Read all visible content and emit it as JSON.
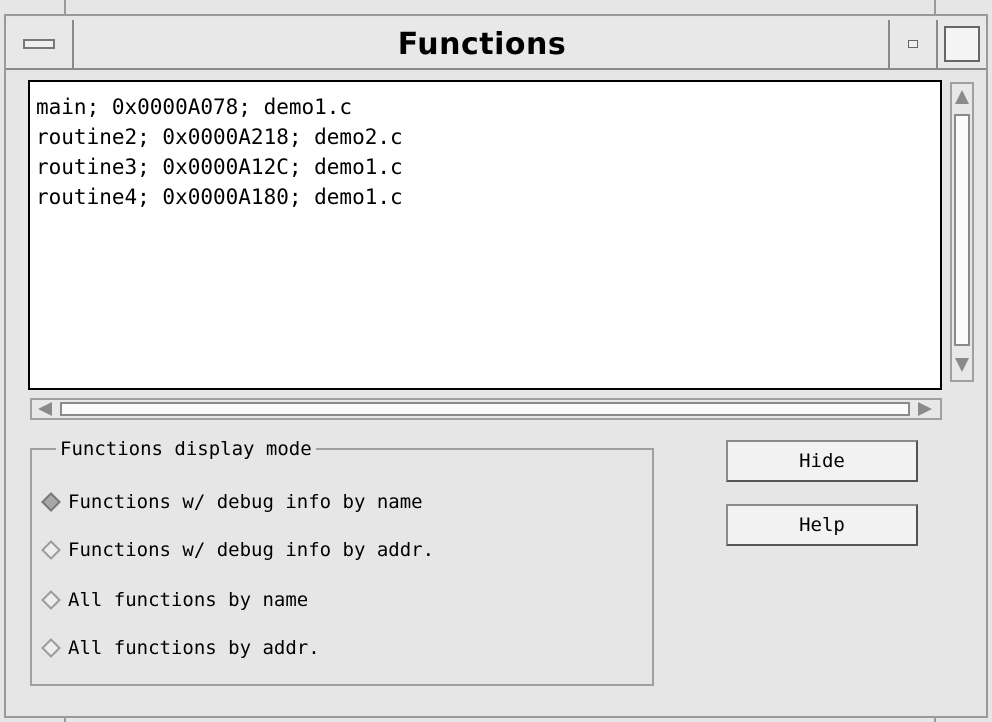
{
  "window": {
    "title": "Functions"
  },
  "functions_list": [
    "main; 0x0000A078; demo1.c",
    "routine2; 0x0000A218; demo2.c",
    "routine3; 0x0000A12C; demo1.c",
    "routine4; 0x0000A180; demo1.c"
  ],
  "display_mode": {
    "label": "Functions display mode",
    "options": [
      "Functions w/ debug info by name",
      "Functions w/ debug info by addr.",
      "All functions by name",
      "All functions by addr."
    ],
    "selected_index": 0
  },
  "buttons": {
    "hide": "Hide",
    "help": "Help"
  },
  "icons": {
    "window_menu": "window-menu-icon",
    "minimize": "minimize-icon",
    "maximize": "maximize-icon",
    "scroll_up": "arrow-up-icon",
    "scroll_down": "arrow-down-icon",
    "scroll_left": "arrow-left-icon",
    "scroll_right": "arrow-right-icon"
  }
}
